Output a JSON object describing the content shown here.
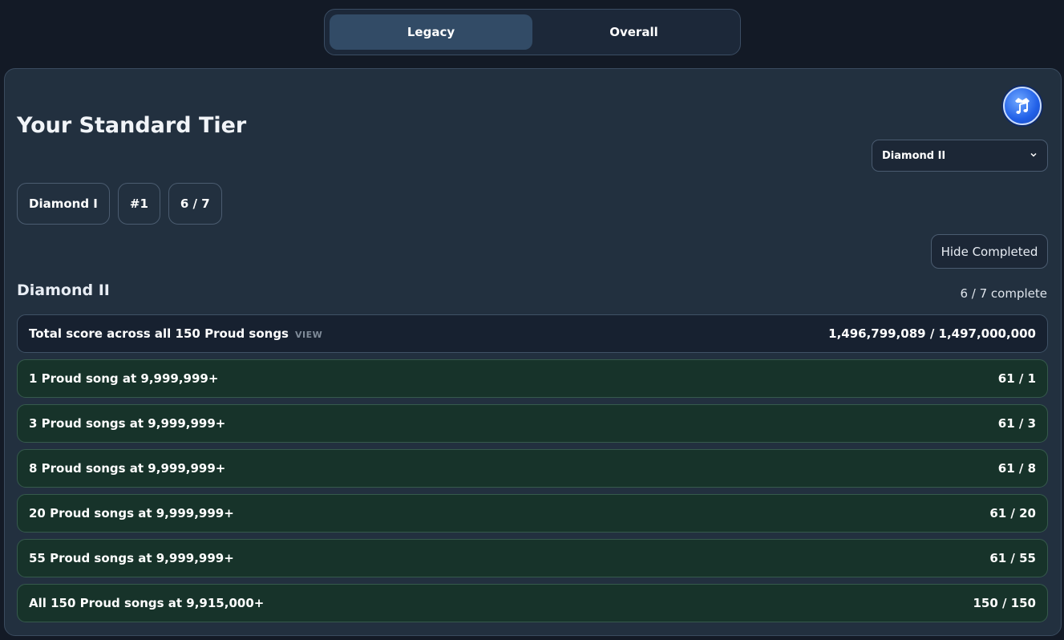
{
  "tabs": [
    {
      "label": "Legacy",
      "active": true
    },
    {
      "label": "Overall",
      "active": false
    }
  ],
  "header": {
    "title": "Your Standard Tier",
    "icon": "music-crown-icon",
    "tier_select": {
      "value": "Diamond II"
    }
  },
  "stats": {
    "tier": "Diamond I",
    "rank": "#1",
    "progress": "6 / 7"
  },
  "hide_completed_label": "Hide Completed",
  "section": {
    "title": "Diamond II",
    "count": "6 / 7 complete"
  },
  "rows": [
    {
      "label": "Total score across all 150 Proud songs",
      "link": "VIEW",
      "value": "1,496,799,089 / 1,497,000,000",
      "status": "pending"
    },
    {
      "label": "1 Proud song at 9,999,999+",
      "value": "61 / 1",
      "status": "done"
    },
    {
      "label": "3 Proud songs at 9,999,999+",
      "value": "61 / 3",
      "status": "done"
    },
    {
      "label": "8 Proud songs at 9,999,999+",
      "value": "61 / 8",
      "status": "done"
    },
    {
      "label": "20 Proud songs at 9,999,999+",
      "value": "61 / 20",
      "status": "done"
    },
    {
      "label": "55 Proud songs at 9,999,999+",
      "value": "61 / 55",
      "status": "done"
    },
    {
      "label": "All 150 Proud songs at 9,915,000+",
      "value": "150 / 150",
      "status": "done"
    }
  ],
  "colors": {
    "background": "#131a26",
    "panel": "#22303f",
    "row_done": "#17332a",
    "row_pending": "#172130",
    "badge_blue": "#2160e8"
  }
}
